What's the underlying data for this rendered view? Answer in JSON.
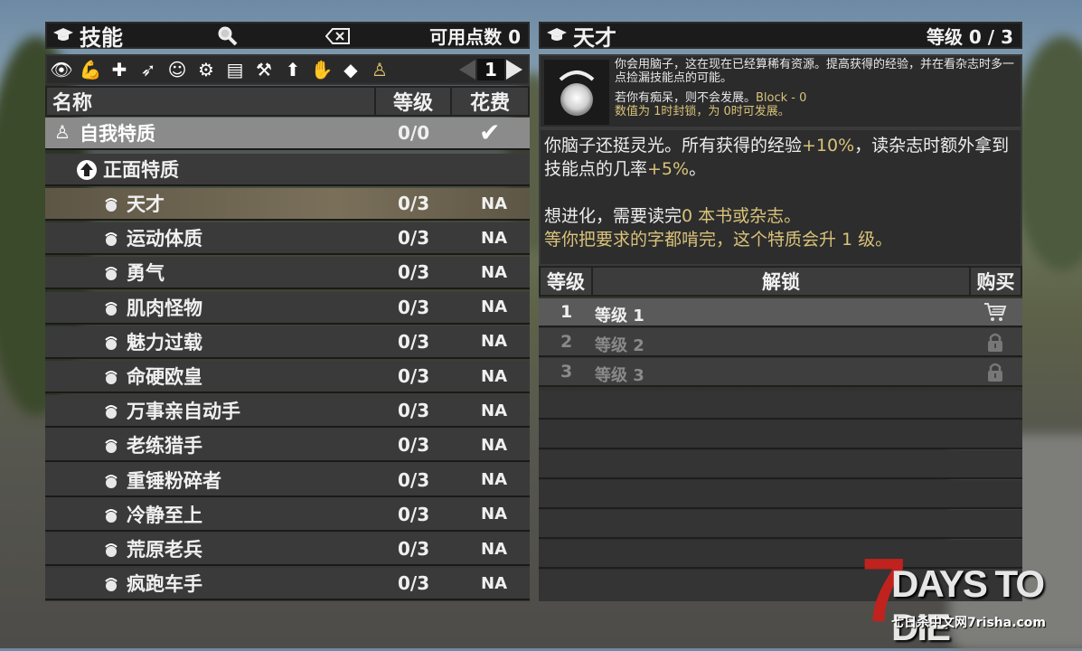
{
  "left_header": {
    "title": "技能",
    "points": "可用点数 0"
  },
  "right_header": {
    "title": "天才",
    "level": "等级 0 / 3"
  },
  "pager": {
    "page": "1"
  },
  "toolbar_icons": [
    "eye-icon",
    "muscle-icon",
    "plus-icon",
    "sneak-icon",
    "brain-icon",
    "gear-icon",
    "book-icon",
    "hammer-icon",
    "upgrade-icon",
    "hand-icon",
    "diamond-icon",
    "trait-icon"
  ],
  "columns": {
    "name": "名称",
    "level": "等级",
    "cost": "花费"
  },
  "attribute": {
    "name": "自我特质",
    "level": "0/0"
  },
  "category": {
    "name": "正面特质"
  },
  "perks": [
    {
      "name": "天才",
      "level": "0/3",
      "cost": "NA"
    },
    {
      "name": "运动体质",
      "level": "0/3",
      "cost": "NA"
    },
    {
      "name": "勇气",
      "level": "0/3",
      "cost": "NA"
    },
    {
      "name": "肌肉怪物",
      "level": "0/3",
      "cost": "NA"
    },
    {
      "name": "魅力过载",
      "level": "0/3",
      "cost": "NA"
    },
    {
      "name": "命硬欧皇",
      "level": "0/3",
      "cost": "NA"
    },
    {
      "name": "万事亲自动手",
      "level": "0/3",
      "cost": "NA"
    },
    {
      "name": "老练猎手",
      "level": "0/3",
      "cost": "NA"
    },
    {
      "name": "重锤粉碎者",
      "level": "0/3",
      "cost": "NA"
    },
    {
      "name": "冷静至上",
      "level": "0/3",
      "cost": "NA"
    },
    {
      "name": "荒原老兵",
      "level": "0/3",
      "cost": "NA"
    },
    {
      "name": "疯跑车手",
      "level": "0/3",
      "cost": "NA"
    }
  ],
  "description": {
    "line1": "你会用脑子，这在现在已经算稀有资源。提高获得的经验，并在看杂志时多一点捡漏技能点的可能。",
    "line2": "若你有痴呆，则不会发展。",
    "block": "Block - 0",
    "line3": "数值为 1时封锁，为 0时可发展。"
  },
  "long_desc": {
    "p1a": "你脑子还挺灵光。所有获得的经验",
    "p1b": "+10%",
    "p1c": "，读杂志时额外拿到技能点的几率",
    "p1d": "+5%",
    "p1e": "。",
    "p2a": "想进化，需要读完",
    "p2b": "0 本书或杂志。",
    "p3": "等你把要求的字都啃完，这个特质会升 1 级。"
  },
  "table_header": {
    "level": "等级",
    "unlock": "解锁",
    "buy": "购买"
  },
  "levels": [
    {
      "num": "1",
      "label": "等级 1",
      "icon": "cart-icon"
    },
    {
      "num": "2",
      "label": "等级 2",
      "icon": "lock-icon"
    },
    {
      "num": "3",
      "label": "等级 3",
      "icon": "lock-icon"
    }
  ],
  "logo": {
    "main": "DAYS TO DIE",
    "seven": "7",
    "site": "七日杀中文网7risha.com"
  },
  "colors": {
    "selected_row": "#6f6650",
    "highlight": "#d9c27a",
    "logo_red": "#c0221e"
  }
}
